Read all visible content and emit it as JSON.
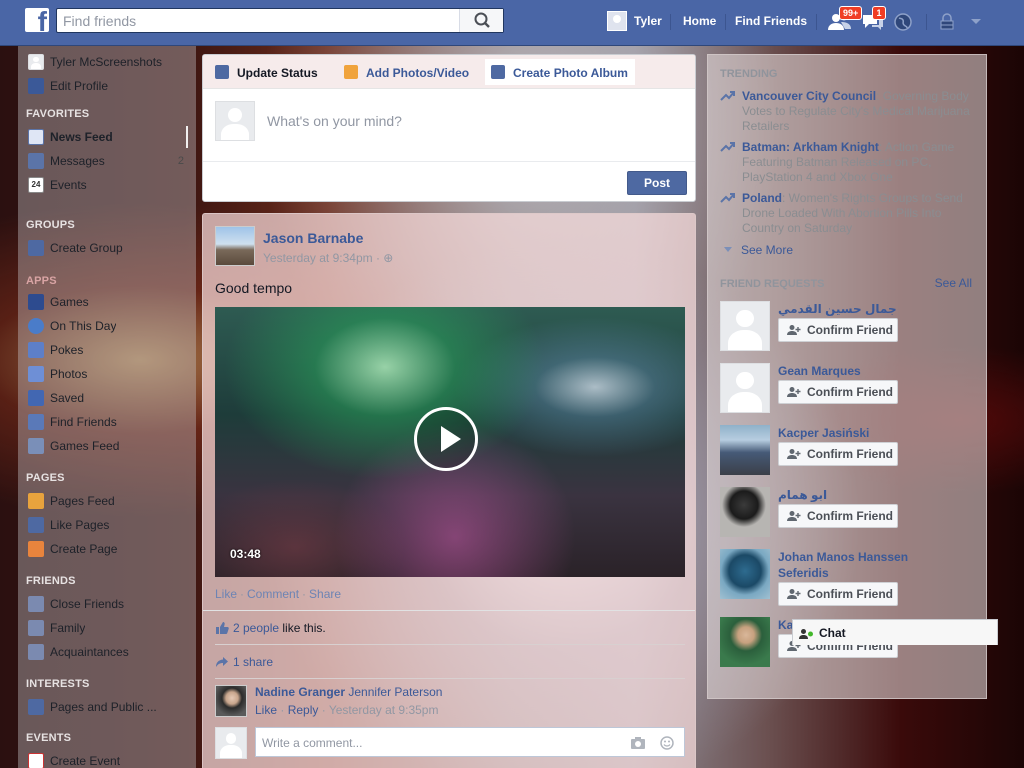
{
  "topbar": {
    "search_placeholder": "Find friends",
    "user_name": "Tyler",
    "home": "Home",
    "find_friends": "Find Friends",
    "friend_requests_badge": "99+",
    "messages_badge": "1"
  },
  "leftnav": {
    "profile_name": "Tyler McScreenshots",
    "edit_profile": "Edit Profile",
    "favorites_header": "FAVORITES",
    "favorites": [
      {
        "label": "News Feed",
        "count": ""
      },
      {
        "label": "Messages",
        "count": "2"
      },
      {
        "label": "Events",
        "count": ""
      }
    ],
    "groups_header": "GROUPS",
    "create_group": "Create Group",
    "apps_header": "APPS",
    "apps": [
      "Games",
      "On This Day",
      "Pokes",
      "Photos",
      "Saved",
      "Find Friends",
      "Games Feed"
    ],
    "pages_header": "PAGES",
    "pages": [
      "Pages Feed",
      "Like Pages",
      "Create Page"
    ],
    "friends_header": "FRIENDS",
    "friends": [
      "Close Friends",
      "Family",
      "Acquaintances"
    ],
    "interests_header": "INTERESTS",
    "interests": [
      "Pages and Public ..."
    ],
    "events_header": "EVENTS",
    "events": [
      "Create Event"
    ]
  },
  "composer": {
    "tabs": [
      "Update Status",
      "Add Photos/Video",
      "Create Photo Album"
    ],
    "placeholder": "What's on your mind?",
    "post_button": "Post"
  },
  "story": {
    "author": "Jason Barnabe",
    "time": "Yesterday at 9:34pm · ",
    "text": "Good tempo",
    "video_duration": "03:48",
    "actions": [
      "Like",
      "Comment",
      "Share"
    ],
    "likes_link": "2 people",
    "likes_suffix": " like this.",
    "shares": "1 share",
    "comment": {
      "author": "Nadine Granger",
      "text": "Jennifer Paterson",
      "like": "Like",
      "reply": "Reply",
      "time": "Yesterday at 9:35pm"
    },
    "comment_placeholder": "Write a comment..."
  },
  "trending": {
    "header": "TRENDING",
    "items": [
      {
        "name": "Vancouver City Council",
        "desc": ": Governing Body Votes to Regulate City's Medical Marijuana Retailers"
      },
      {
        "name": "Batman: Arkham Knight",
        "desc": ": Action Game Featuring Batman Released on PC, PlayStation 4 and Xbox One"
      },
      {
        "name": "Poland",
        "desc": ": Women's Rights Groups to Send Drone Loaded With Abortion Pills Into Country on Saturday"
      }
    ],
    "see_more": "See More"
  },
  "friend_requests": {
    "header": "FRIEND REQUESTS",
    "see_all": "See All",
    "confirm_label": "Confirm Friend",
    "items": [
      {
        "name": "جمال حسين القدمي"
      },
      {
        "name": "Gean Marques"
      },
      {
        "name": "Kacper Jasiński"
      },
      {
        "name": "ابو همام"
      },
      {
        "name": "Johan Manos Hanssen Seferidis"
      },
      {
        "name": "Ka"
      }
    ]
  },
  "chat": {
    "label": "Chat"
  },
  "colors": {
    "brand_blue": "#4a66a6",
    "link_blue": "#3b5998",
    "badge_red": "#f03d25"
  }
}
